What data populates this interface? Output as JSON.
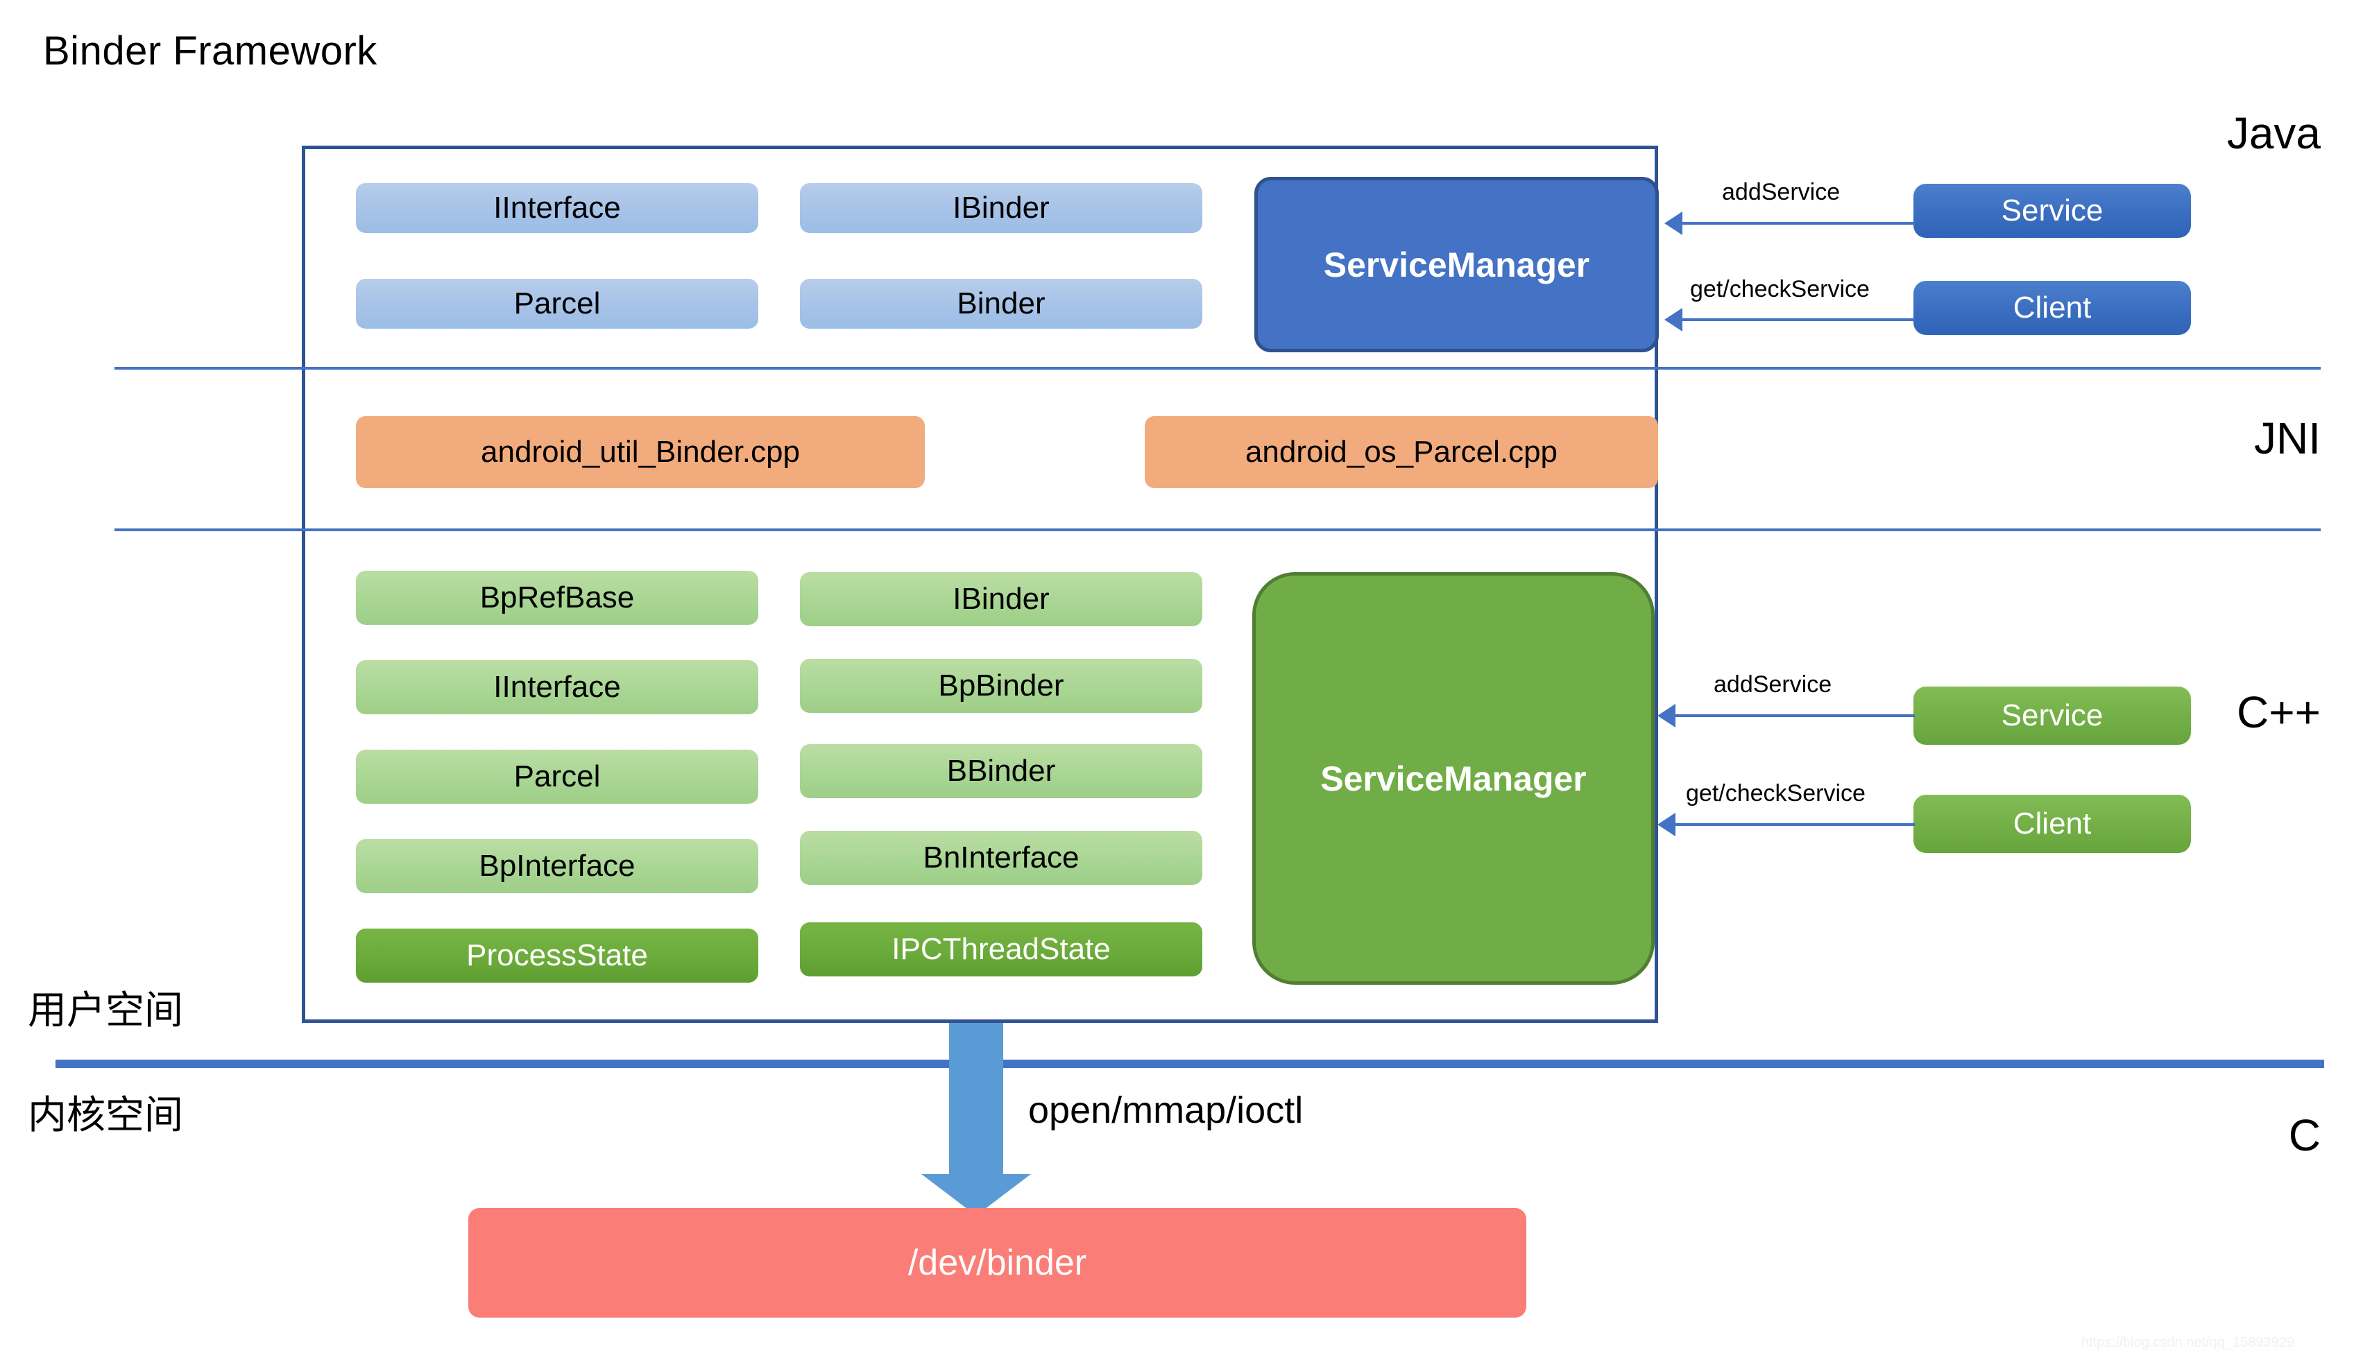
{
  "title": "Binder Framework",
  "layer_labels": {
    "java": "Java",
    "jni": "JNI",
    "cpp": "C++",
    "c": "C"
  },
  "space_labels": {
    "user": "用户空间",
    "kernel": "内核空间"
  },
  "java_layer": {
    "pills_left": [
      "IInterface",
      "Parcel"
    ],
    "pills_right": [
      "IBinder",
      "Binder"
    ],
    "service_manager": "ServiceManager",
    "actors": [
      "Service",
      "Client"
    ],
    "connectors": [
      "addService",
      "get/checkService"
    ]
  },
  "jni_layer": {
    "pills": [
      "android_util_Binder.cpp",
      "android_os_Parcel.cpp"
    ]
  },
  "cpp_layer": {
    "pills_left": [
      "BpRefBase",
      "IInterface",
      "Parcel",
      "BpInterface",
      "ProcessState"
    ],
    "pills_right": [
      "IBinder",
      "BpBinder",
      "BBinder",
      "BnInterface",
      "IPCThreadState"
    ],
    "service_manager": "ServiceManager",
    "actors": [
      "Service",
      "Client"
    ],
    "connectors": [
      "addService",
      "get/checkService"
    ]
  },
  "kernel": {
    "syscall_label": "open/mmap/ioctl",
    "device_node": "/dev/binder"
  },
  "watermark": "https://blog.csdn.net/qq_15893929",
  "colors": {
    "frame_border": "#2E5395",
    "divider": "#4472C4",
    "java_pill": "#A9C4E8",
    "jni_pill": "#F2AB7C",
    "cpp_pill": "#A9D694",
    "cpp_pill_dark": "#6BAB3B",
    "service_manager_java": "#4472C4",
    "service_manager_cpp": "#70AD47",
    "arrow": "#5B9BD5",
    "device_node": "#FA7D77"
  }
}
